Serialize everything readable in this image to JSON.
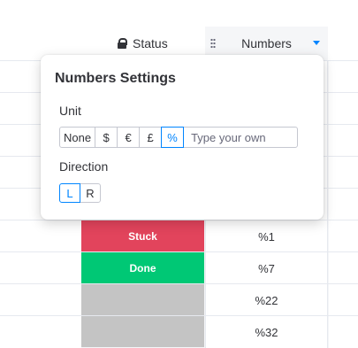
{
  "columns": {
    "status": {
      "label": "Status",
      "icon": "lock-icon"
    },
    "numbers": {
      "label": "Numbers",
      "drag_icon": "drag-handle-icon",
      "menu_icon": "chevron-down-icon",
      "accent": "#0085ff"
    }
  },
  "rows": [
    {
      "status": "",
      "status_color": "",
      "number": ""
    },
    {
      "status": "",
      "status_color": "",
      "number": ""
    },
    {
      "status": "",
      "status_color": "",
      "number": ""
    },
    {
      "status": "",
      "status_color": "",
      "number": ""
    },
    {
      "status": "",
      "status_color": "",
      "number": ""
    },
    {
      "status": "Stuck",
      "status_color": "#e2445c",
      "number": "%1"
    },
    {
      "status": "Done",
      "status_color": "#00c875",
      "number": "%7"
    },
    {
      "status": "",
      "status_color": "#c4c4c4",
      "number": "%22"
    },
    {
      "status": "",
      "status_color": "#c4c4c4",
      "number": "%32"
    }
  ],
  "popup": {
    "title": "Numbers Settings",
    "unit_label": "Unit",
    "units": [
      {
        "label": "None",
        "selected": false
      },
      {
        "label": "$",
        "selected": false
      },
      {
        "label": "€",
        "selected": false
      },
      {
        "label": "£",
        "selected": false
      },
      {
        "label": "%",
        "selected": true
      }
    ],
    "custom_unit_placeholder": "Type your own",
    "direction_label": "Direction",
    "directions": [
      {
        "label": "L",
        "selected": true
      },
      {
        "label": "R",
        "selected": false
      }
    ]
  }
}
